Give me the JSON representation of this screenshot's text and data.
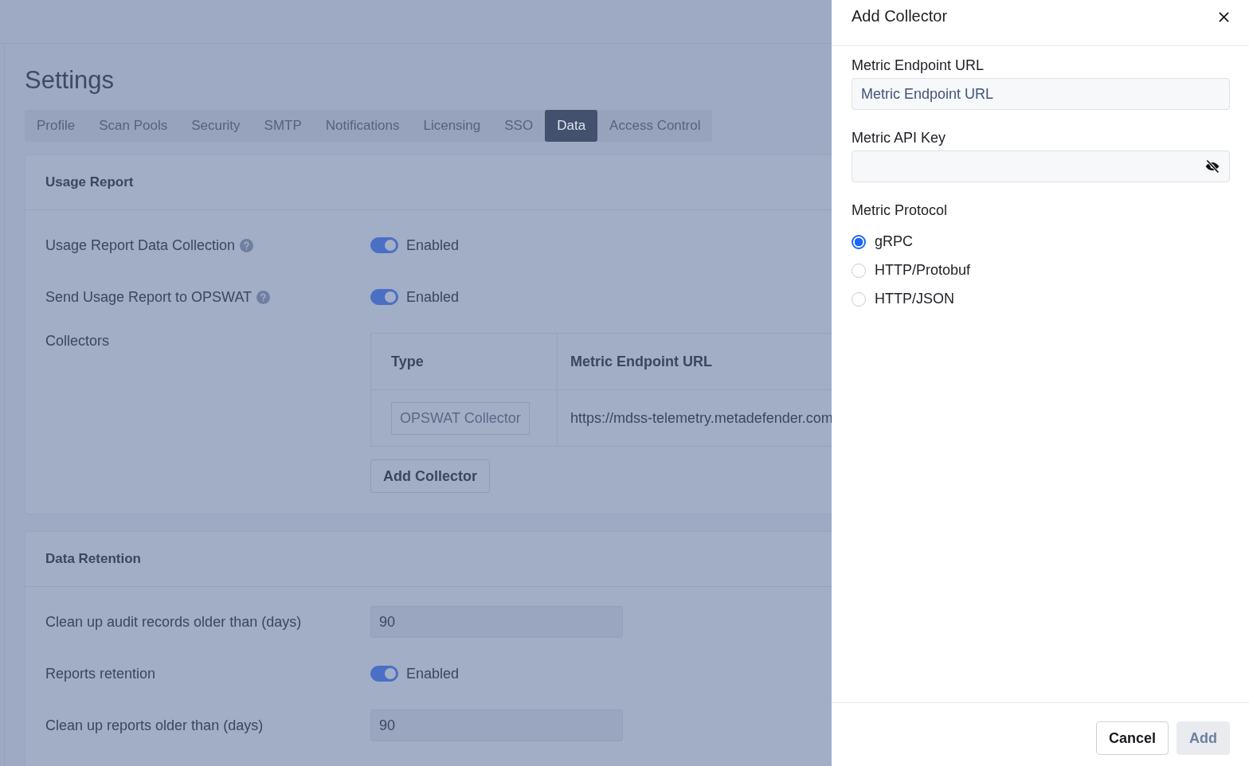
{
  "page": {
    "title": "Settings",
    "tabs": [
      {
        "label": "Profile",
        "selected": false
      },
      {
        "label": "Scan Pools",
        "selected": false
      },
      {
        "label": "Security",
        "selected": false
      },
      {
        "label": "SMTP",
        "selected": false
      },
      {
        "label": "Notifications",
        "selected": false
      },
      {
        "label": "Licensing",
        "selected": false
      },
      {
        "label": "SSO",
        "selected": false
      },
      {
        "label": "Data",
        "selected": true
      },
      {
        "label": "Access Control",
        "selected": false
      }
    ],
    "sections": [
      {
        "title": "Usage Report",
        "rows": [
          {
            "kind": "toggle",
            "label": "Usage Report Data Collection",
            "help": true,
            "on": true,
            "state_label": "Enabled"
          },
          {
            "kind": "toggle",
            "label": "Send Usage Report to OPSWAT",
            "help": true,
            "on": true,
            "state_label": "Enabled"
          },
          {
            "kind": "collectors",
            "label": "Collectors",
            "columns": [
              "Type",
              "Metric Endpoint URL"
            ],
            "rows": [
              {
                "type": "OPSWAT Collector",
                "url": "https://mdss-telemetry.metadefender.com"
              }
            ],
            "button": "Add Collector"
          }
        ]
      },
      {
        "title": "Data Retention",
        "rows": [
          {
            "kind": "number",
            "label": "Clean up audit records older than (days)",
            "value": "90"
          },
          {
            "kind": "toggle",
            "label": "Reports retention",
            "help": false,
            "on": true,
            "state_label": "Enabled"
          },
          {
            "kind": "number",
            "label": "Clean up reports older than (days)",
            "value": "90"
          }
        ]
      }
    ]
  },
  "drawer": {
    "title": "Add Collector",
    "endpoint": {
      "label": "Metric Endpoint URL",
      "placeholder": "Metric Endpoint URL"
    },
    "api_key": {
      "label": "Metric API Key"
    },
    "protocol": {
      "label": "Metric Protocol",
      "options": [
        {
          "label": "gRPC",
          "selected": true
        },
        {
          "label": "HTTP/Protobuf",
          "selected": false
        },
        {
          "label": "HTTP/JSON",
          "selected": false
        }
      ]
    },
    "buttons": [
      {
        "label": "Cancel",
        "disabled": false
      },
      {
        "label": "Add",
        "disabled": true
      }
    ]
  }
}
